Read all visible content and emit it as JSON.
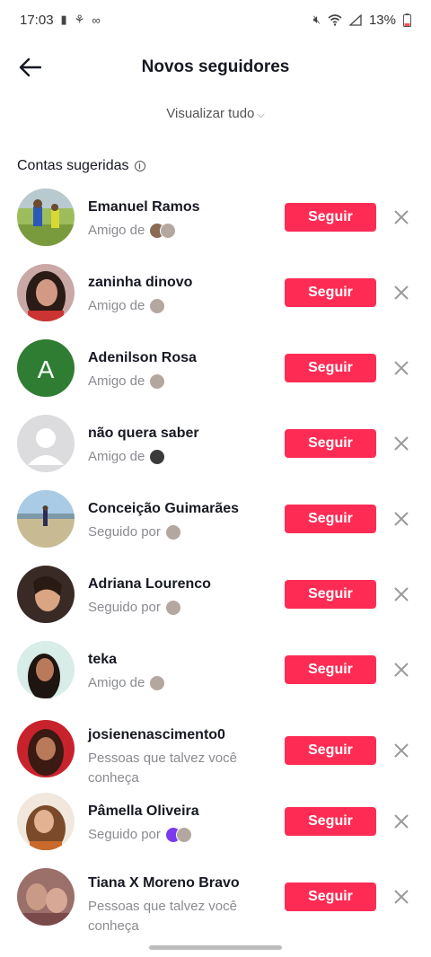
{
  "status": {
    "time": "17:03",
    "battery": "13%"
  },
  "header": {
    "title": "Novos seguidores"
  },
  "view_all": "Visualizar tudo",
  "section": {
    "title": "Contas sugeridas"
  },
  "accounts": [
    {
      "name": "Emanuel Ramos",
      "relation": "Amigo de",
      "button": "Seguir"
    },
    {
      "name": "zaninha dinovo",
      "relation": "Amigo de",
      "button": "Seguir"
    },
    {
      "name": "Adenilson Rosa",
      "relation": "Amigo de",
      "button": "Seguir",
      "initial": "A"
    },
    {
      "name": "não quera saber",
      "relation": "Amigo de",
      "button": "Seguir"
    },
    {
      "name": "Conceição Guimarães",
      "relation": "Seguido por",
      "button": "Seguir"
    },
    {
      "name": "Adriana Lourenco",
      "relation": "Seguido por",
      "button": "Seguir"
    },
    {
      "name": "teka",
      "relation": "Amigo de",
      "button": "Seguir"
    },
    {
      "name": "josienenascimento0",
      "relation": "Pessoas que talvez você conheça",
      "button": "Seguir"
    },
    {
      "name": "Pâmella Oliveira",
      "relation": "Seguido por",
      "button": "Seguir"
    },
    {
      "name": "Tiana X Moreno Bravo",
      "relation": "Pessoas que talvez você conheça",
      "button": "Seguir"
    }
  ],
  "colors": {
    "accent": "#fe2c55",
    "text": "#161823",
    "secondary": "#8a8b91"
  }
}
